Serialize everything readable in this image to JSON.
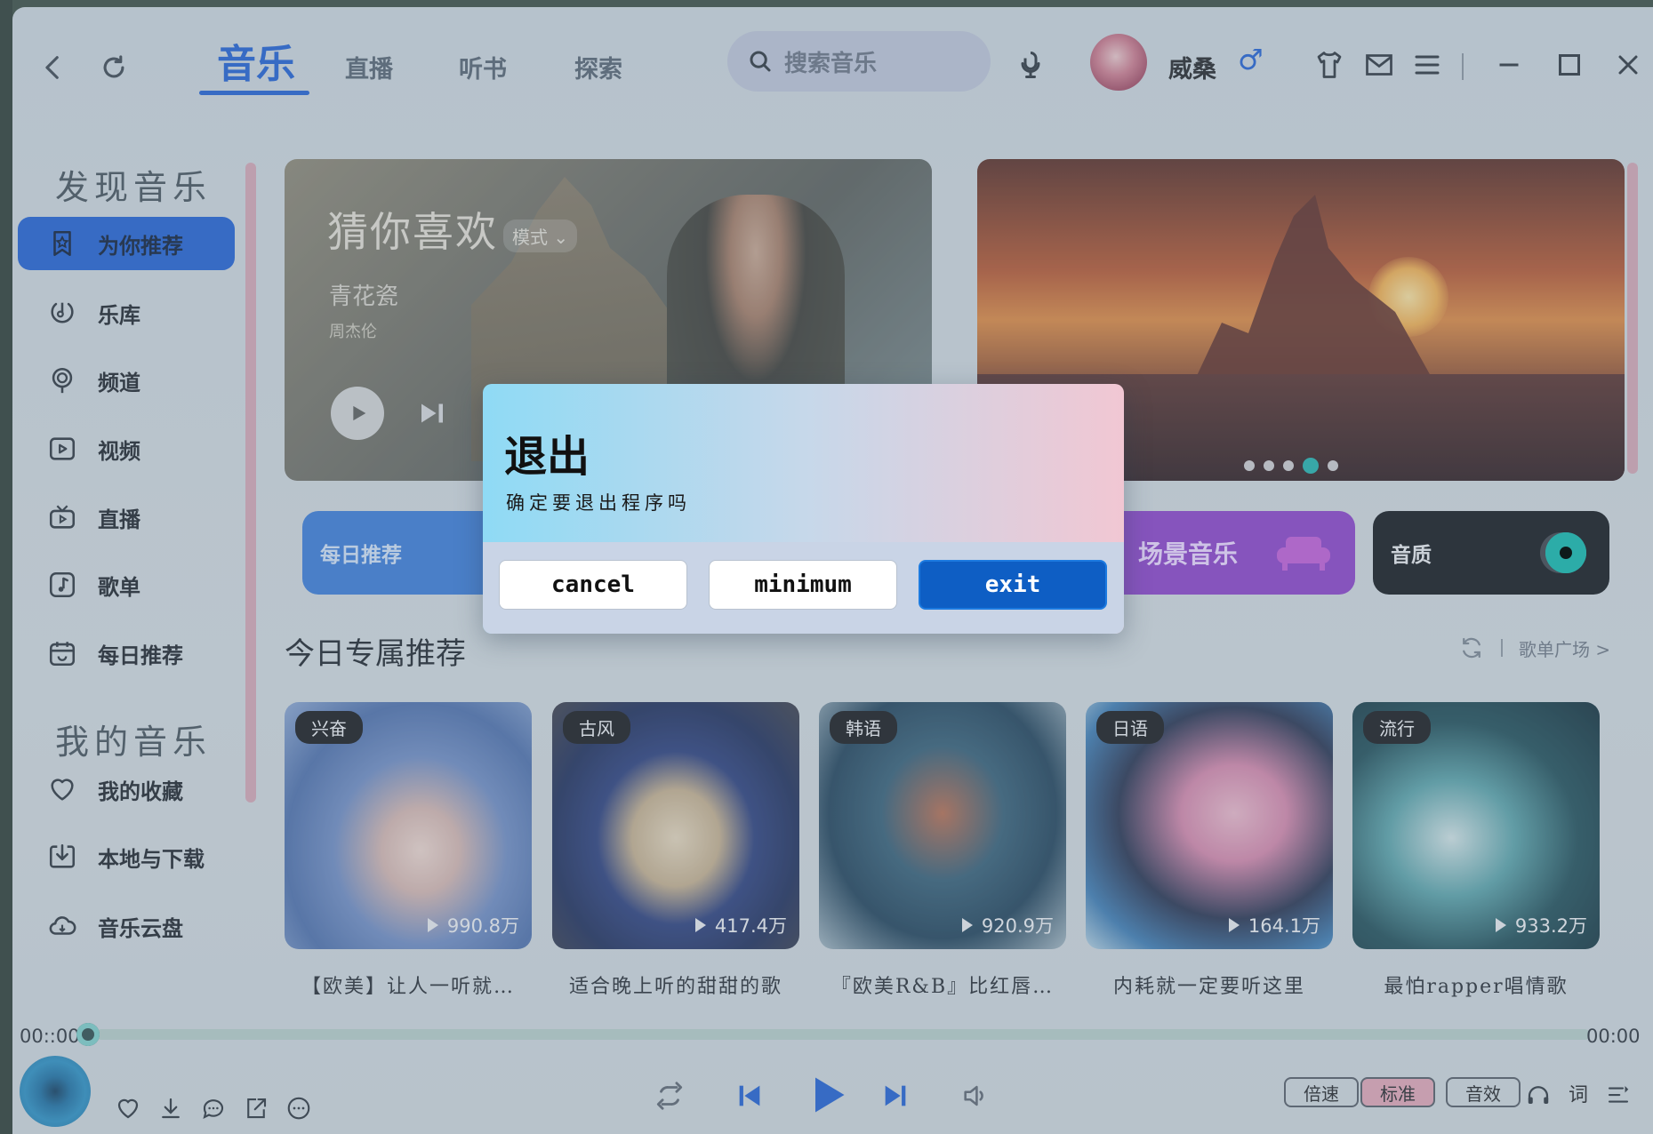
{
  "header": {
    "tabs": [
      {
        "label": "音乐",
        "active": true
      },
      {
        "label": "直播"
      },
      {
        "label": "听书"
      },
      {
        "label": "探索"
      }
    ],
    "search": {
      "placeholder": "搜索音乐"
    },
    "user": {
      "name": "威桑",
      "gender_symbol": "♂"
    },
    "icons": [
      "back-icon",
      "refresh-icon",
      "voice-icon",
      "shirt-icon",
      "mail-icon",
      "menu-icon",
      "minimize-icon",
      "maximize-icon",
      "close-icon"
    ]
  },
  "sidebar": {
    "section1_title": "发现音乐",
    "section2_title": "我的音乐",
    "items": [
      {
        "label": "为你推荐",
        "icon": "recommend-icon",
        "active": true
      },
      {
        "label": "乐库",
        "icon": "library-icon"
      },
      {
        "label": "频道",
        "icon": "channel-icon"
      },
      {
        "label": "视频",
        "icon": "video-icon"
      },
      {
        "label": "直播",
        "icon": "live-icon"
      },
      {
        "label": "歌单",
        "icon": "playlist-icon"
      },
      {
        "label": "每日推荐",
        "icon": "calendar-icon"
      }
    ],
    "my_items": [
      {
        "label": "我的收藏",
        "icon": "heart-icon"
      },
      {
        "label": "本地与下载",
        "icon": "download-icon"
      },
      {
        "label": "音乐云盘",
        "icon": "cloud-icon"
      }
    ]
  },
  "banner": {
    "title": "猜你喜欢",
    "mode": "模式",
    "song": "青花瓷",
    "artist": "周杰伦",
    "carousel_active_index": 3,
    "carousel_count": 5
  },
  "quick_cards": {
    "daily": "每日推荐",
    "scene": "场景音乐",
    "quality": "音质"
  },
  "section": {
    "title": "今日专属推荐",
    "more": "歌单广场 >"
  },
  "playlists": [
    {
      "tag": "兴奋",
      "plays": "990.8万",
      "title": "【欧美】让人一听就…"
    },
    {
      "tag": "古风",
      "plays": "417.4万",
      "title": "适合晚上听的甜甜的歌"
    },
    {
      "tag": "韩语",
      "plays": "920.9万",
      "title": "『欧美R&B』比红唇…"
    },
    {
      "tag": "日语",
      "plays": "164.1万",
      "title": "内耗就一定要听这里"
    },
    {
      "tag": "流行",
      "plays": "933.2万",
      "title": "最怕rapper唱情歌"
    }
  ],
  "player": {
    "current_time": "00::00",
    "total_time": "00:00",
    "progress": 0,
    "pills": {
      "speed": "倍速",
      "standard": "标准",
      "effect": "音效"
    },
    "lyrics": "词"
  },
  "dialog": {
    "title": "退出",
    "message": "确定要退出程序吗",
    "buttons": {
      "cancel": "cancel",
      "minimum": "minimum",
      "exit": "exit"
    }
  },
  "colors": {
    "accent": "#1f5fd0",
    "dialog_primary": "#0e5ec4",
    "teal": "#10b9a9",
    "scene_purple": "#8d3fc6"
  }
}
